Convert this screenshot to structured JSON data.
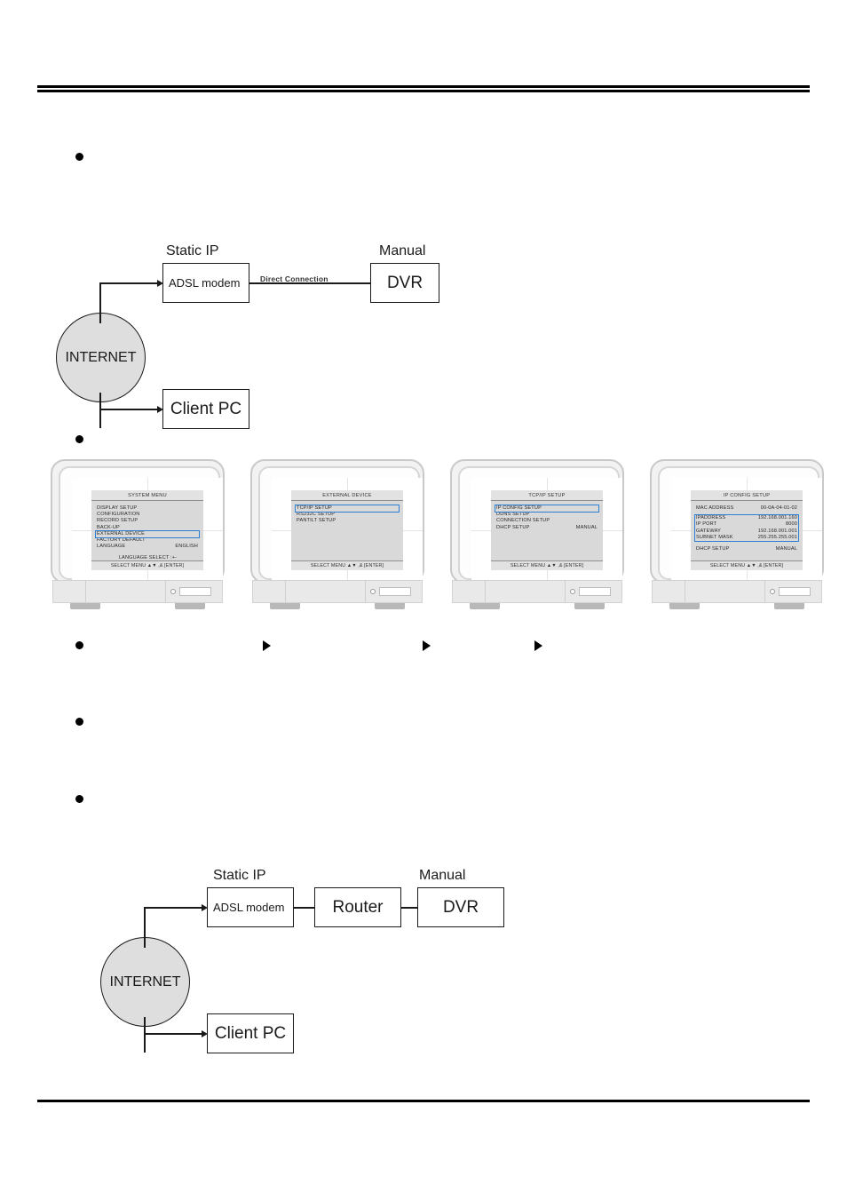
{
  "document": {
    "bullets": [
      "",
      "",
      "",
      "",
      ""
    ]
  },
  "diagram_top": {
    "name": "direct-connection-topology",
    "internet_label": "INTERNET",
    "modem_caption": "Static IP",
    "modem_label": "ADSL modem",
    "dvr_caption": "Manual",
    "dvr_label": "DVR",
    "connection_label": "Direct Connection",
    "client_label": "Client PC"
  },
  "diagram_bottom": {
    "name": "router-connection-topology",
    "internet_label": "INTERNET",
    "modem_caption": "Static IP",
    "modem_label": "ADSL modem",
    "router_label": "Router",
    "dvr_caption": "Manual",
    "dvr_label": "DVR",
    "client_label": "Client PC"
  },
  "flow": {
    "arrow_glyph": "▶",
    "monitors": [
      {
        "id": "system-menu",
        "title": "SYSTEM MENU",
        "rows": [
          {
            "label": "DISPLAY SETUP",
            "value": ""
          },
          {
            "label": "CONFIGURATION",
            "value": ""
          },
          {
            "label": "RECORD SETUP",
            "value": ""
          },
          {
            "label": "BACK-UP",
            "value": ""
          },
          {
            "label": "EXTERNAL DEVICE",
            "value": ""
          },
          {
            "label": "FACTORY DEFAULT",
            "value": ""
          },
          {
            "label": "LANGUAGE",
            "value": "ENGLISH"
          }
        ],
        "center_note": "LANGUAGE SELECT  :+-",
        "footer": "SELECT MENU ▲▼ ,& [ENTER]",
        "highlight_index": 4,
        "highlight_color": "#2a7fd4"
      },
      {
        "id": "external-device",
        "title": "EXTERNAL DEVICE",
        "rows": [
          {
            "label": "TCP/IP SETUP",
            "value": ""
          },
          {
            "label": "RS232C SETUP",
            "value": ""
          },
          {
            "label": "PANTILT SETUP",
            "value": ""
          }
        ],
        "center_note": "",
        "footer": "SELECT MENU ▲▼ ,& [ENTER]",
        "highlight_index": 0,
        "highlight_color": "#2a7fd4"
      },
      {
        "id": "tcp-ip-setup",
        "title": "TCP/IP SETUP",
        "rows": [
          {
            "label": "IP CONFIG SETUP",
            "value": ""
          },
          {
            "label": "DDNS SETUP",
            "value": ""
          },
          {
            "label": "CONNECTION SETUP",
            "value": ""
          },
          {
            "label": "DHCP SETUP",
            "value": "MANUAL"
          }
        ],
        "center_note": "",
        "footer": "SELECT MENU ▲▼ ,& [ENTER]",
        "highlight_index": 0,
        "highlight_color": "#2a7fd4"
      },
      {
        "id": "ip-config-setup",
        "title": "IP CONFIG SETUP",
        "rows": [
          {
            "label": "MAC ADDRESS",
            "value": "00-0A-04-01-02"
          },
          {
            "label": "IPADDRESS",
            "value": "192.168.001.160"
          },
          {
            "label": "IP PORT",
            "value": "8000"
          },
          {
            "label": "GATEWAY",
            "value": "192.168.001.001"
          },
          {
            "label": "SUBNET MASK",
            "value": "255.255.255.001"
          },
          {
            "label": "DHCP SETUP",
            "value": "MANUAL"
          }
        ],
        "center_note": "",
        "footer": "SELECT MENU ▲▼ ,& [ENTER]",
        "highlight_group": [
          1,
          4
        ],
        "highlight_color": "#2a7fd4"
      }
    ]
  }
}
